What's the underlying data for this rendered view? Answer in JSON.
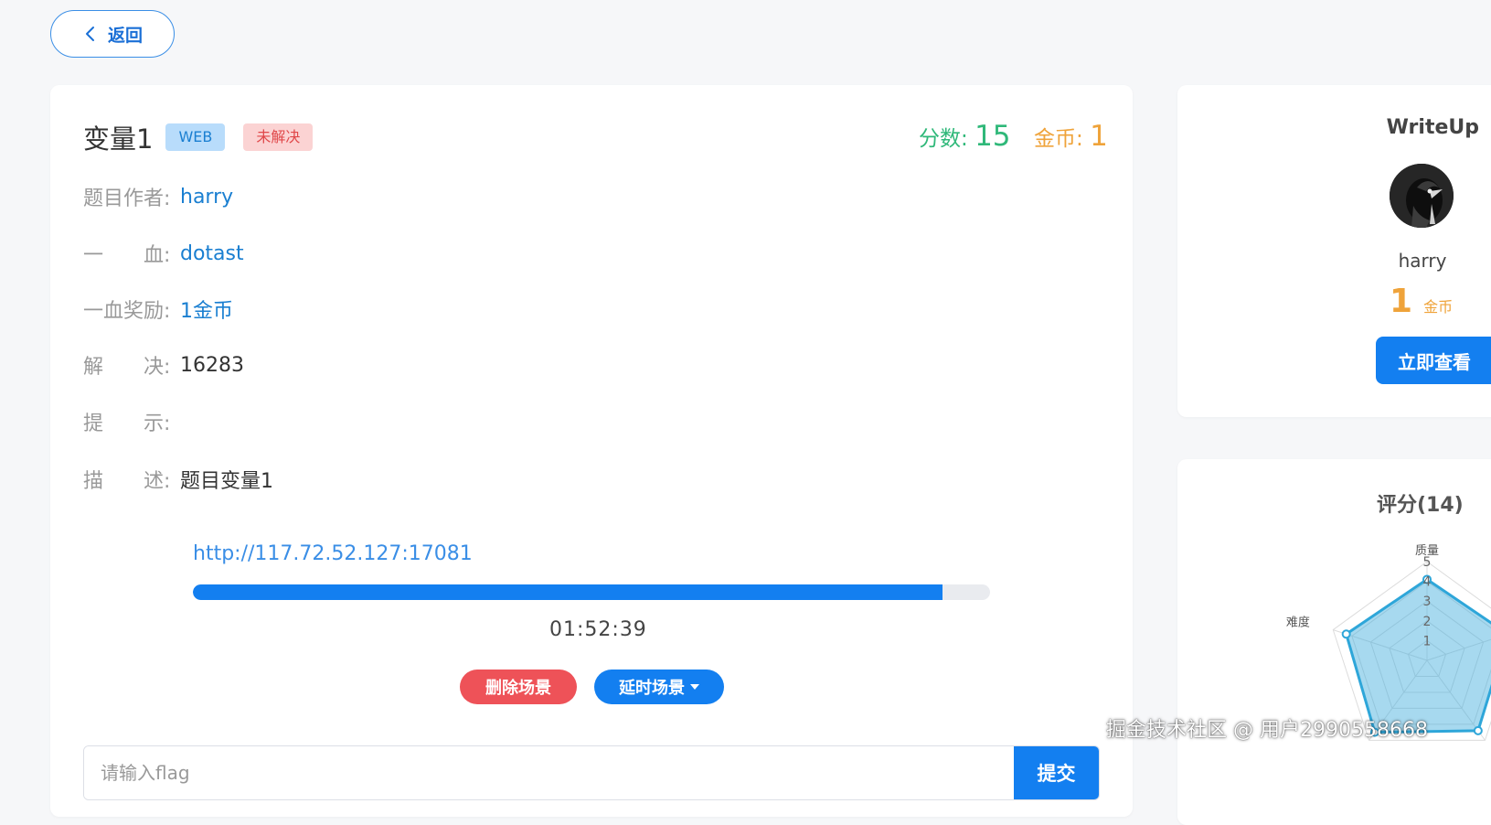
{
  "nav": {
    "back_label": "返回"
  },
  "challenge": {
    "title": "变量1",
    "category_tag": "WEB",
    "status_tag": "未解决",
    "points_label": "分数:",
    "points_value": "15",
    "coins_label": "金币:",
    "coins_value": "1",
    "fields": {
      "author_label": "题目作者:",
      "author_value": "harry",
      "firstblood_label": "一　　血:",
      "firstblood_value": "dotast",
      "reward_label": "一血奖励:",
      "reward_value": "1金币",
      "solved_label": "解　　决:",
      "solved_value": "16283",
      "hint_label": "提　　示:",
      "hint_value": "",
      "desc_label": "描　　述:",
      "desc_value": "题目变量1"
    },
    "instance": {
      "url": "http://117.72.52.127:17081",
      "remaining_fraction": 0.94,
      "timer": "01:52:39",
      "delete_label": "删除场景",
      "extend_label": "延时场景"
    },
    "flag": {
      "placeholder": "请输入flag",
      "submit_label": "提交"
    }
  },
  "writeup": {
    "title": "WriteUp",
    "author": "harry",
    "coin_value": "1",
    "coin_unit": "金币",
    "view_label": "立即查看"
  },
  "rating": {
    "title": "评分(14)",
    "axes": [
      "质量",
      "难度"
    ],
    "ticks": [
      "5",
      "4",
      "3",
      "2",
      "1"
    ],
    "max": 5,
    "values": [
      4.1,
      4.3,
      4.4,
      4.5,
      4.3
    ]
  },
  "watermark": "掘金技术社区 @ 用户2990558668",
  "colors": {
    "primary": "#137ff0",
    "success": "#2fb879",
    "warning": "#efa33a",
    "danger": "#ee5258"
  }
}
